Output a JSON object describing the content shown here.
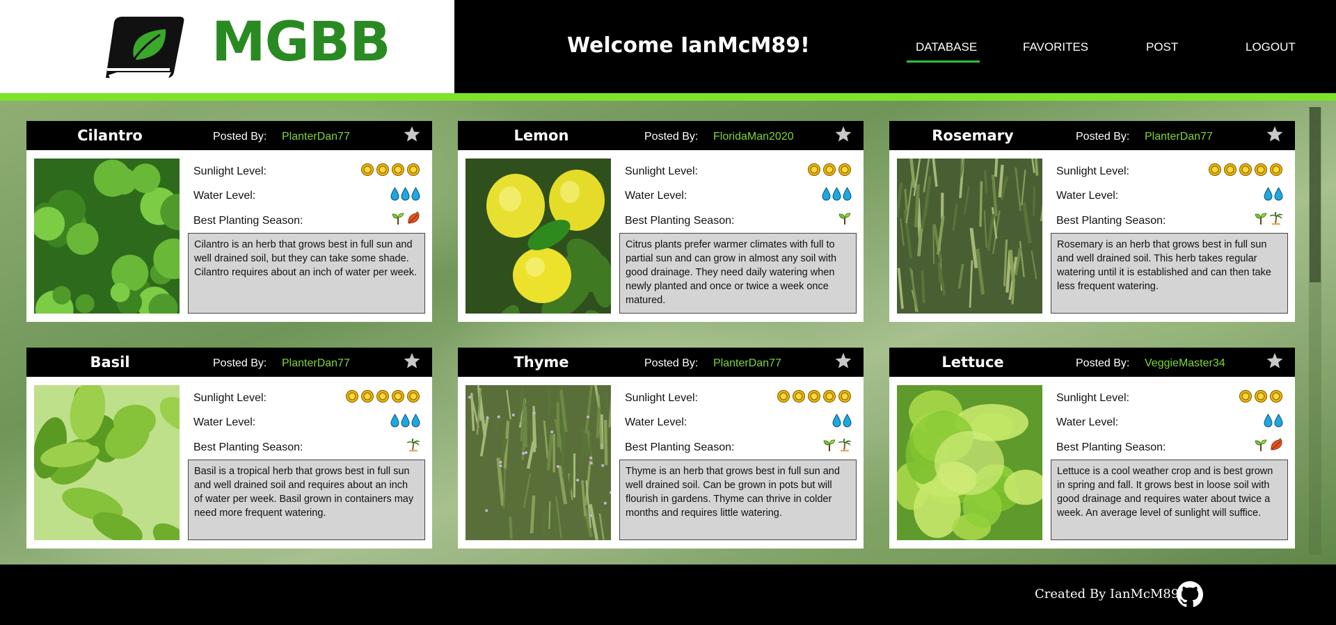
{
  "brand": {
    "name": "MGBB"
  },
  "header": {
    "welcome": "Welcome IanMcM89!"
  },
  "nav": [
    {
      "label": "DATABASE",
      "active": true
    },
    {
      "label": "FAVORITES",
      "active": false
    },
    {
      "label": "POST",
      "active": false
    },
    {
      "label": "LOGOUT",
      "active": false
    }
  ],
  "labels": {
    "posted_by": "Posted By:",
    "sunlight": "Sunlight Level:",
    "water": "Water Level:",
    "season": "Best Planting Season:"
  },
  "colors": {
    "brand_green": "#2a8a22",
    "accent_strip": "#7ee22a",
    "username_green": "#7fd82f",
    "nav_underline": "#2ec13a",
    "description_bg": "#d4d4d4"
  },
  "plants": [
    {
      "name": "Cilantro",
      "posted_by": "PlanterDan77",
      "sunlight": 4,
      "water": 3,
      "seasons": [
        "spring-sprout-icon",
        "fall-leaf-icon"
      ],
      "description": "Cilantro is an herb that grows best in full sun and well drained soil, but they can take some shade. Cilantro requires about an inch of water per week.",
      "image": "cilantro-photo"
    },
    {
      "name": "Lemon",
      "posted_by": "FloridaMan2020",
      "sunlight": 3,
      "water": 3,
      "seasons": [
        "spring-sprout-icon"
      ],
      "description": "Citrus plants prefer warmer climates with full to partial sun and can grow in almost any soil with good drainage. They need daily watering when newly planted and once or twice a week once matured.",
      "image": "lemon-photo"
    },
    {
      "name": "Rosemary",
      "posted_by": "PlanterDan77",
      "sunlight": 5,
      "water": 2,
      "seasons": [
        "spring-sprout-icon",
        "summer-palm-icon"
      ],
      "description": "Rosemary is an herb that grows best in full sun and well drained soil. This herb takes regular watering until it is established and can then take less frequent watering.",
      "image": "rosemary-photo"
    },
    {
      "name": "Basil",
      "posted_by": "PlanterDan77",
      "sunlight": 5,
      "water": 3,
      "seasons": [
        "summer-palm-icon"
      ],
      "description": "Basil is a tropical herb that grows best in full sun and well drained soil and requires about an inch of water per week. Basil grown in containers may need more frequent watering.",
      "image": "basil-photo"
    },
    {
      "name": "Thyme",
      "posted_by": "PlanterDan77",
      "sunlight": 5,
      "water": 2,
      "seasons": [
        "spring-sprout-icon",
        "summer-palm-icon"
      ],
      "description": "Thyme is an herb that grows best in full sun and well drained soil. Can be grown in pots but will flourish in gardens. Thyme can thrive in colder months and requires little watering.",
      "image": "thyme-photo"
    },
    {
      "name": "Lettuce",
      "posted_by": "VeggieMaster34",
      "sunlight": 3,
      "water": 2,
      "seasons": [
        "spring-sprout-icon",
        "fall-leaf-icon"
      ],
      "description": "Lettuce is a cool weather crop and is best grown in spring and fall. It grows best in loose soil with good drainage and requires water about twice a week. An average level of sunlight will suffice.",
      "image": "lettuce-photo"
    }
  ],
  "footer": {
    "credit": "Created By IanMcM89"
  }
}
